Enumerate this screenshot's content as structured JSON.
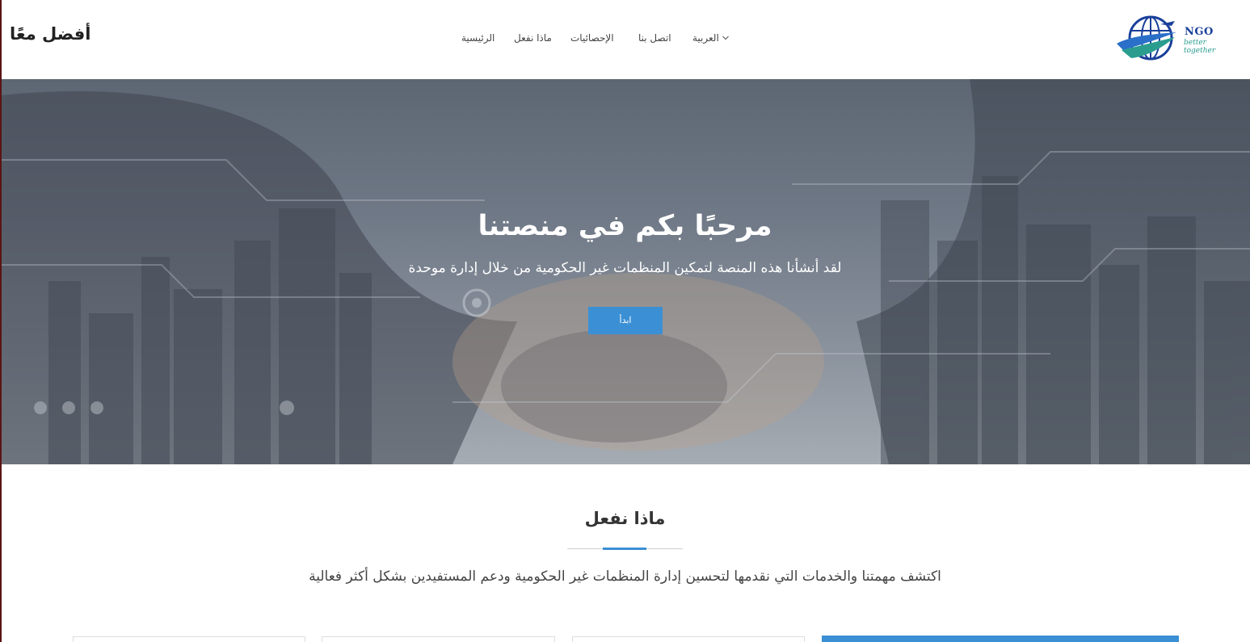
{
  "navbar": {
    "brand": "أفضل معًا",
    "links": {
      "home": "الرئيسية",
      "what_we_do": "ماذا نفعل",
      "statistics": "الإحصائيات",
      "contact": "اتصل بنا",
      "language": "العربية"
    },
    "logo": {
      "name": "NGO",
      "tagline": "better together"
    }
  },
  "hero": {
    "title": "مرحبًا بكم في منصتنا",
    "subtitle": "لقد أنشأنا هذه المنصة لتمكين المنظمات غير الحكومية من خلال إدارة موحدة",
    "button": "ابدأ"
  },
  "section": {
    "title": "ماذا نفعل",
    "description": "اكتشف مهمتنا والخدمات التي نقدمها لتحسين إدارة المنظمات غير الحكومية ودعم المستفيدين بشكل أكثر فعالية"
  },
  "colors": {
    "accent": "#3b8fd4",
    "logo_blue": "#1a3f9a",
    "logo_teal": "#2a9d8f"
  }
}
